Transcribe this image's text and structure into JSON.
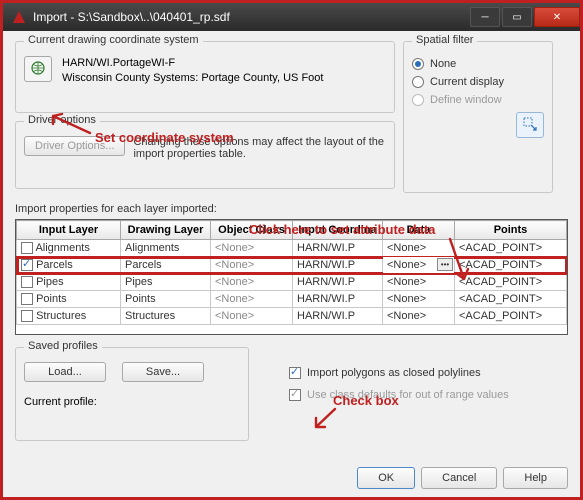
{
  "titlebar": {
    "text": "Import - S:\\Sandbox\\..\\040401_rp.sdf"
  },
  "coord": {
    "legend": "Current drawing coordinate system",
    "name": "HARN/WI.PortageWI-F",
    "desc": "Wisconsin County Systems: Portage County, US Foot"
  },
  "spatial": {
    "legend": "Spatial filter",
    "none": "None",
    "current": "Current display",
    "define": "Define window"
  },
  "driver": {
    "legend": "Driver options",
    "button": "Driver Options...",
    "note": "Changing these options may affect the layout of the import properties table."
  },
  "table": {
    "caption": "Import properties for each layer imported:",
    "headers": {
      "input_layer": "Input Layer",
      "drawing_layer": "Drawing Layer",
      "object_class": "Object Class",
      "input_coord": "Input Coordina",
      "data": "Data",
      "points": "Points"
    },
    "rows": [
      {
        "input": "Alignments",
        "drawing": "Alignments",
        "oclass": "<None>",
        "coord": "HARN/WI.P",
        "data": "<None>",
        "points": "<ACAD_POINT>"
      },
      {
        "input": "Parcels",
        "drawing": "Parcels",
        "oclass": "<None>",
        "coord": "HARN/WI.P",
        "data": "<None>",
        "points": "<ACAD_POINT>"
      },
      {
        "input": "Pipes",
        "drawing": "Pipes",
        "oclass": "<None>",
        "coord": "HARN/WI.P",
        "data": "<None>",
        "points": "<ACAD_POINT>"
      },
      {
        "input": "Points",
        "drawing": "Points",
        "oclass": "<None>",
        "coord": "HARN/WI.P",
        "data": "<None>",
        "points": "<ACAD_POINT>"
      },
      {
        "input": "Structures",
        "drawing": "Structures",
        "oclass": "<None>",
        "coord": "HARN/WI.P",
        "data": "<None>",
        "points": "<ACAD_POINT>"
      }
    ]
  },
  "saved": {
    "legend": "Saved profiles",
    "load": "Load...",
    "save": "Save...",
    "current_label": "Current profile:"
  },
  "options": {
    "polylines": "Import polygons as closed polylines",
    "defaults": "Use class defaults for out of range values"
  },
  "footer": {
    "ok": "OK",
    "cancel": "Cancel",
    "help": "Help"
  },
  "anno": {
    "coord": "Set coordinate system",
    "attr": "Click here to set attribute data",
    "check": "Check box"
  }
}
